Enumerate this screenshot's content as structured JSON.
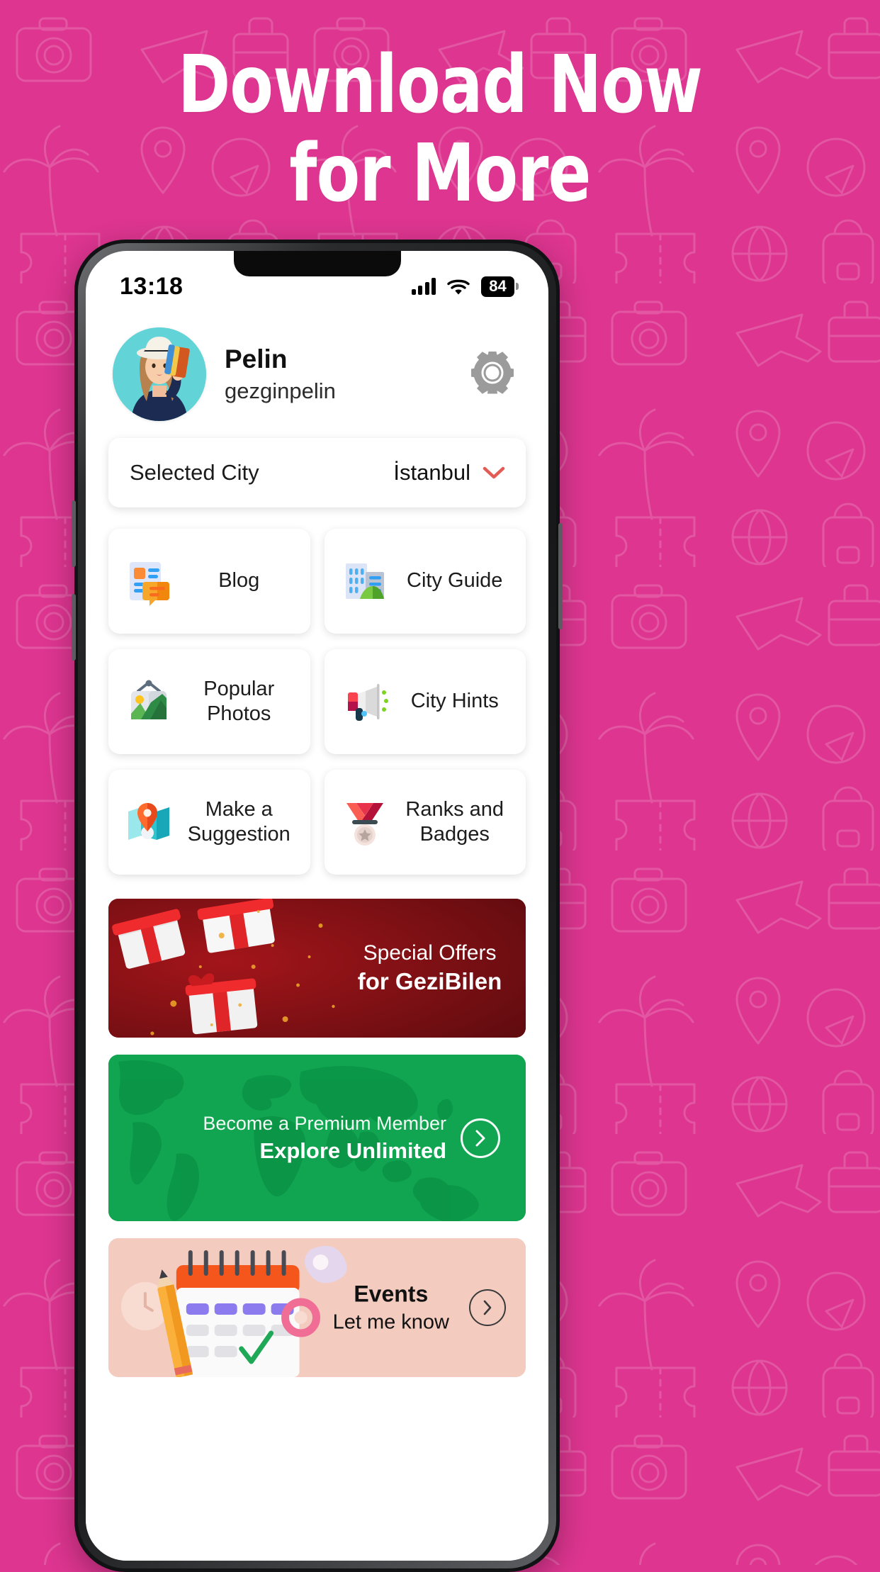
{
  "promo": {
    "headline": "Download Now\nfor More",
    "background_color": "#DD3590"
  },
  "status_bar": {
    "time": "13:18",
    "battery_percent": "84",
    "signal_icon": "cellular-signal-icon",
    "wifi_icon": "wifi-icon"
  },
  "profile": {
    "name": "Pelin",
    "handle": "gezginpelin",
    "settings_icon": "gear-icon"
  },
  "city_selector": {
    "label": "Selected City",
    "value": "İstanbul",
    "chevron_icon": "chevron-down-icon",
    "chevron_color": "#E35B55"
  },
  "tiles": [
    {
      "label": "Blog",
      "icon": "blog-article-icon"
    },
    {
      "label": "City Guide",
      "icon": "city-buildings-icon"
    },
    {
      "label": "Popular Photos",
      "icon": "photo-landscape-icon"
    },
    {
      "label": "City Hints",
      "icon": "megaphone-icon"
    },
    {
      "label": "Make a\nSuggestion",
      "icon": "map-pin-icon"
    },
    {
      "label": "Ranks and\nBadges",
      "icon": "medal-icon"
    }
  ],
  "banners": {
    "special_offers": {
      "line1": "Special Offers",
      "line2": "for GeziBilen",
      "accent_color": "#8B1014"
    },
    "premium": {
      "line1": "Become a Premium Member",
      "line2": "Explore Unlimited",
      "accent_color": "#0CA14A",
      "arrow_icon": "chevron-right-circle-icon"
    },
    "events": {
      "line1": "Events",
      "line2": "Let me know",
      "accent_color": "#F3C8BA",
      "arrow_icon": "chevron-right-circle-icon"
    }
  }
}
